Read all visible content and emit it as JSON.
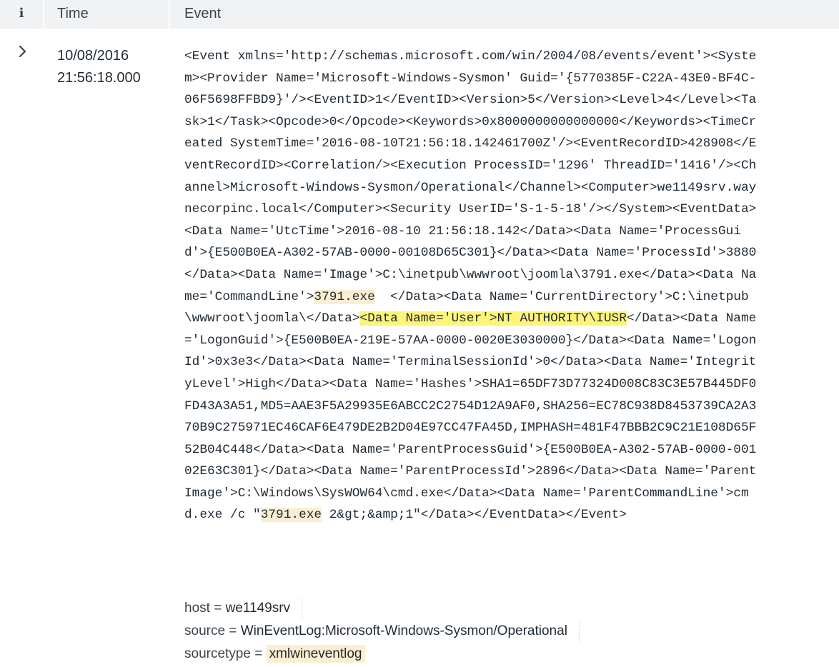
{
  "header": {
    "info_label": "i",
    "time_label": "Time",
    "event_label": "Event"
  },
  "event": {
    "expand_icon": "chevron-right-icon",
    "time_date": "10/08/2016",
    "time_clock": "21:56:18.000",
    "raw_lines": [
      [
        "<Event xmlns='http://schemas.microsoft.com/win/2004/08/events/event'><Syste"
      ],
      [
        "m><Provider Name='Microsoft-Windows-Sysmon' Guid='{5770385F-C22A-43E0-BF4C-"
      ],
      [
        "06F5698FFBD9}'/><EventID>1</EventID><Version>5</Version><Level>4</Level><Ta"
      ],
      [
        "sk>1</Task><Opcode>0</Opcode><Keywords>0x8000000000000000</Keywords><TimeCr"
      ],
      [
        "eated SystemTime='2016-08-10T21:56:18.142461700Z'/><EventRecordID>428908</E"
      ],
      [
        "ventRecordID><Correlation/><Execution ProcessID='1296' ThreadID='1416'/><Ch"
      ],
      [
        "annel>Microsoft-Windows-Sysmon/Operational</Channel><Computer>we1149srv.way"
      ],
      [
        "necorpinc.local</Computer><Security UserID='S-1-5-18'/></System><EventData>"
      ],
      [
        "<Data Name='UtcTime'>2016-08-10 21:56:18.142</Data><Data Name='ProcessGui"
      ],
      [
        "d'>{E500B0EA-A302-57AB-0000-00108D65C301}</Data><Data Name='ProcessId'>3880"
      ],
      [
        "</Data><Data Name='Image'>C:\\inetpub\\wwwroot\\joomla\\3791.exe</Data><Data Na"
      ],
      [
        "me='CommandLine'>",
        {
          "t": "3791.exe",
          "hl": "orange"
        },
        "  </Data><Data Name='CurrentDirectory'>C:\\inetpub"
      ],
      [
        "\\wwwroot\\joomla\\</Data>",
        {
          "t": "<Data Name='User'>NT AUTHORITY\\IUSR",
          "hl": "yellow"
        },
        "</Data><Data Name"
      ],
      [
        "='LogonGuid'>{E500B0EA-219E-57AA-0000-0020E3030000}</Data><Data Name='Logon"
      ],
      [
        "Id'>0x3e3</Data><Data Name='TerminalSessionId'>0</Data><Data Name='Integrit"
      ],
      [
        "yLevel'>High</Data><Data Name='Hashes'>SHA1=65DF73D77324D008C83C3E57B445DF0"
      ],
      [
        "FD43A3A51,MD5=AAE3F5A29935E6ABCC2C2754D12A9AF0,SHA256=EC78C938D8453739CA2A3"
      ],
      [
        "70B9C275971EC46CAF6E479DE2B2D04E97CC47FA45D,IMPHASH=481F47BBB2C9C21E108D65F"
      ],
      [
        "52B04C448</Data><Data Name='ParentProcessGuid'>{E500B0EA-A302-57AB-0000-001"
      ],
      [
        "02E63C301}</Data><Data Name='ParentProcessId'>2896</Data><Data Name='Parent"
      ],
      [
        "Image'>C:\\Windows\\SysWOW64\\cmd.exe</Data><Data Name='ParentCommandLine'>cm"
      ],
      [
        "d.exe /c \"",
        {
          "t": "3791.exe",
          "hl": "orange"
        },
        " 2&gt;&amp;1\"</Data></EventData></Event>"
      ]
    ],
    "fields": [
      {
        "key": "host",
        "eq": " = ",
        "value": "we1149srv",
        "highlight": false
      },
      {
        "key": "source",
        "eq": " = ",
        "value": "WinEventLog:Microsoft-Windows-Sysmon/Operational",
        "highlight": false
      },
      {
        "key": "sourcetype",
        "eq": " = ",
        "value": "xmlwineventlog",
        "highlight": true
      }
    ]
  },
  "colors": {
    "header_bg": "#f0f2f4",
    "highlight_orange": "#fbeed2",
    "highlight_yellow": "#fff47a"
  }
}
